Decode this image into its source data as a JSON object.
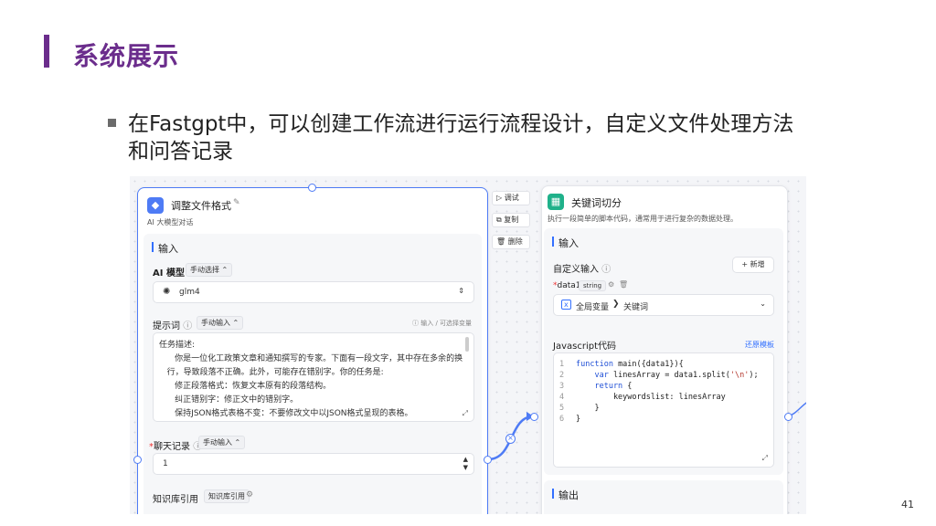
{
  "slide": {
    "title": "系统展示",
    "bullet": "在Fastgpt中，可以创建工作流进行运行流程设计，自定义文件处理方法和问答记录",
    "page_number": "41"
  },
  "node_left": {
    "title": "调整文件格式",
    "subtitle": "AI 大模型对话",
    "input_section": "输入",
    "ai_model_label": "AI 模型",
    "ai_model_mode": "手动选择",
    "model_value": "glm4",
    "prompt_label": "提示词",
    "prompt_mode": "手动输入",
    "prompt_hint": "输入 / 可选择变量",
    "prompt_lines": [
      "任务描述:",
      "      你是一位化工政策文章和通知撰写的专家。下面有一段文字，其中存在多余的换",
      "   行，导致段落不正确。此外，可能存在错别字。你的任务是:",
      "      修正段落格式：恢复文本原有的段落结构。",
      "      纠正错别字：修正文中的错别字。",
      "      保持JSON格式表格不变：不要修改文中以JSON格式呈现的表格。"
    ],
    "chat_history_label": "聊天记录",
    "chat_history_mode": "手动输入",
    "chat_history_value": "1",
    "kb_label": "知识库引用",
    "kb_tag": "知识库引用"
  },
  "side_buttons": {
    "debug": "调试",
    "copy": "复制",
    "delete": "删除"
  },
  "node_right": {
    "title": "关键词切分",
    "subtitle": "执行一段简单的脚本代码，通常用于进行复杂的数据处理。",
    "input_section": "输入",
    "custom_input_label": "自定义输入",
    "add_button": "+ 新增",
    "var_name": "data1",
    "var_type": "string",
    "var_ref_scope": "全局变量",
    "var_ref_name": "关键词",
    "code_label": "Javascript代码",
    "restore_template": "还原模板",
    "code_lines": [
      {
        "n": "1",
        "kw": "function ",
        "rest": "main({data1}){"
      },
      {
        "n": "2",
        "kw": "    var ",
        "rest": "linesArray = data1.split(",
        "str": "'\\n'",
        "tail": ");"
      },
      {
        "n": "3",
        "kw": "    return ",
        "rest": "{"
      },
      {
        "n": "4",
        "kw": "",
        "rest": "        keywordslist: linesArray"
      },
      {
        "n": "5",
        "kw": "",
        "rest": "    }"
      },
      {
        "n": "6",
        "kw": "",
        "rest": "}"
      }
    ],
    "output_section": "输出"
  },
  "colors": {
    "title_purple": "#6b2d8c",
    "accent_blue": "#3370ff",
    "node_border": "#4e7bf5",
    "node_icon_left": "#4e7bf5",
    "node_icon_right": "#1fb18a"
  }
}
